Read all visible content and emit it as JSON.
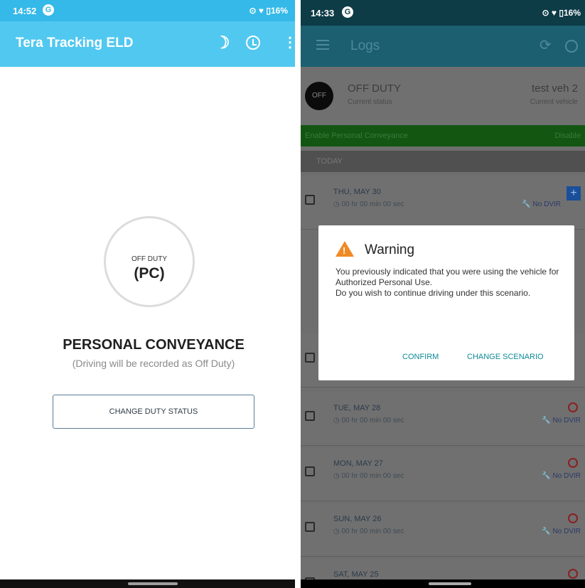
{
  "left_screen": {
    "status_bar": {
      "time": "14:52",
      "g": "G",
      "battery": "16%"
    },
    "app_bar": {
      "title": "Tera Tracking ELD",
      "moon": "☽",
      "more": "⋮"
    },
    "status": {
      "small": "OFF DUTY",
      "big": "(PC)"
    },
    "mode_title": "PERSONAL CONVEYANCE",
    "mode_subtitle": "(Driving will be recorded as Off Duty)",
    "change_button": "CHANGE DUTY STATUS"
  },
  "right_screen": {
    "status_bar": {
      "time": "14:33",
      "g": "G",
      "battery": "16%"
    },
    "app_bar": {
      "title": "Logs",
      "sync": "⟳"
    },
    "current_status": {
      "badge": "OFF",
      "label": "OFF DUTY",
      "label_sub": "Current status",
      "vehicle": "test veh 2",
      "vehicle_sub": "Current vehicle"
    },
    "pc_bar": {
      "left": "Enable Personal Conveyance",
      "right": "Disable"
    },
    "today_header": "TODAY",
    "logs": [
      {
        "date": "THU, MAY 30",
        "hours": "00 hr 00 min 00 sec",
        "dvir": "No DVIR"
      },
      {
        "date": "TUE, MAY 28",
        "hours": "00 hr 00 min 00 sec",
        "dvir": "No DVIR"
      },
      {
        "date": "MON, MAY 27",
        "hours": "00 hr 00 min 00 sec",
        "dvir": "No DVIR"
      },
      {
        "date": "SUN, MAY 26",
        "hours": "00 hr 00 min 00 sec",
        "dvir": "No DVIR"
      },
      {
        "date": "SAT, MAY 25"
      }
    ],
    "dialog": {
      "title": "Warning",
      "body_line1": "You previously indicated that you were using the vehicle for Authorized Personal Use.",
      "body_line2": "Do you wish to continue driving under this scenario.",
      "confirm": "CONFIRM",
      "change": "CHANGE SCENARIO"
    }
  }
}
